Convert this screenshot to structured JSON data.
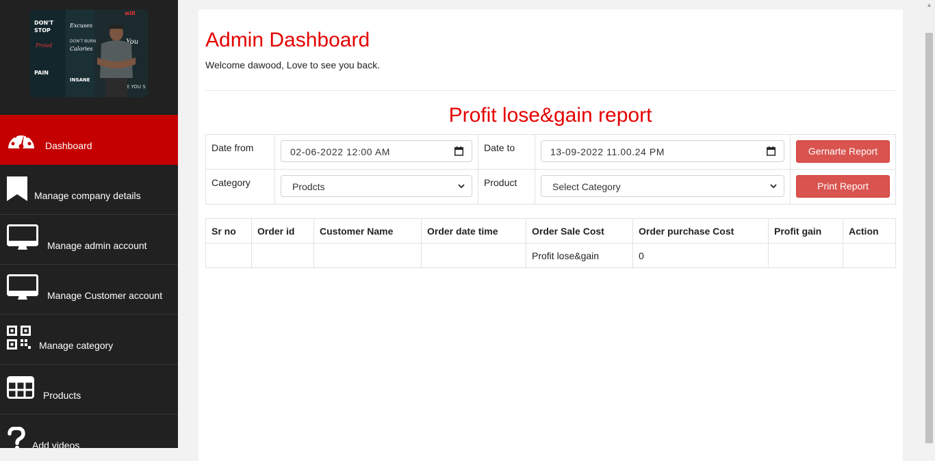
{
  "sidebar": {
    "items": [
      {
        "label": "Dashboard",
        "icon": "gauge-icon",
        "active": true
      },
      {
        "label": "Manage company details",
        "icon": "bookmark-icon"
      },
      {
        "label": "Manage admin account",
        "icon": "monitor-icon"
      },
      {
        "label": "Manage Customer account",
        "icon": "monitor-icon"
      },
      {
        "label": "Manage category",
        "icon": "qr-code-icon"
      },
      {
        "label": "Products",
        "icon": "grid-icon"
      },
      {
        "label": "Add videos",
        "icon": "question-icon"
      }
    ]
  },
  "header": {
    "title": "Admin Dashboard",
    "welcome": "Welcome dawood, Love to see you back."
  },
  "report": {
    "title": "Profit lose&gain report",
    "date_from_label": "Date from",
    "date_from_value": "02-06-2022  12:00  AM",
    "date_to_label": "Date to",
    "date_to_value": "13-09-2022  11.00.24  PM",
    "generate_button": "Gernarte Report",
    "category_label": "Category",
    "category_value": "Prodcts",
    "product_label": "Product",
    "product_value": "Select Category",
    "print_button": "Print Report"
  },
  "table": {
    "headers": [
      "Sr no",
      "Order id",
      "Customer Name",
      "Order date time",
      "Order Sale Cost",
      "Order purchase Cost",
      "Profit gain",
      "Action"
    ],
    "rows": [
      [
        "",
        "",
        "",
        "",
        "Profit lose&gain",
        "0",
        "",
        ""
      ]
    ]
  },
  "colors": {
    "accent": "#e50000",
    "sidebar_bg": "#212121",
    "active_bg": "#c40000",
    "button_bg": "#d9534f"
  }
}
